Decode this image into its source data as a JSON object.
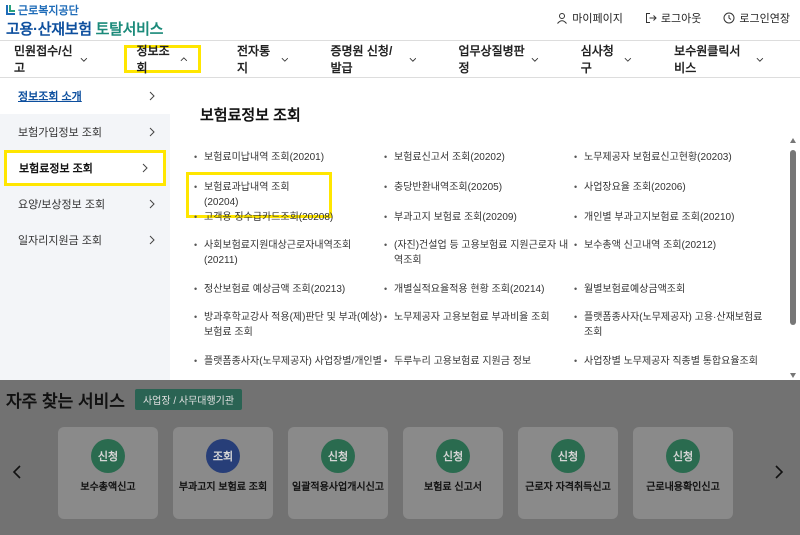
{
  "header": {
    "org": "근로복지공단",
    "service_main": "고용·산재보험",
    "service_sub": "토탈서비스",
    "links": [
      {
        "label": "마이페이지",
        "icon": "person-icon"
      },
      {
        "label": "로그아웃",
        "icon": "logout-icon"
      },
      {
        "label": "로그인연장",
        "icon": "clock-icon"
      }
    ]
  },
  "nav": {
    "items": [
      {
        "label": "민원접수/신고"
      },
      {
        "label": "정보조회"
      },
      {
        "label": "전자통지"
      },
      {
        "label": "증명원 신청/발급"
      },
      {
        "label": "업무상질병판정"
      },
      {
        "label": "심사청구"
      },
      {
        "label": "보수원클릭서비스"
      }
    ],
    "active_index": 1
  },
  "sidebar": {
    "items": [
      {
        "label": "정보조회 소개"
      },
      {
        "label": "보험가입정보 조회"
      },
      {
        "label": "보험료정보 조회"
      },
      {
        "label": "요양/보상정보 조회"
      },
      {
        "label": "일자리지원금 조회"
      }
    ]
  },
  "main": {
    "title": "보험료정보 조회",
    "menu_rows": [
      [
        "보험료미납내역 조회(20201)",
        "보험료신고서 조회(20202)",
        "노무제공자 보험료신고현황(20203)"
      ],
      [
        "보험료과납내역 조회(20204)",
        "충당반환내역조회(20205)",
        "사업장요율 조회(20206)"
      ],
      [
        "고객용 징수급카드조회(20208)",
        "부과고지 보험료 조회(20209)",
        "개인별 부과고지보험료 조회(20210)"
      ],
      [
        "사회보험료지원대상근로자내역조회(20211)",
        "(자진)건설업 등 고용보험료 지원근로자 내역조회",
        "보수총액 신고내역 조회(20212)"
      ],
      [
        "정산보험료 예상금액 조회(20213)",
        "개별실적요율적용 현황 조회(20214)",
        "월별보험료예상금액조회"
      ],
      [
        "방과후학교강사 적용(제)판단 및 부과(예상)보험료 조회",
        "노무제공자 고용보험료 부과비율 조회",
        "플랫폼종사자(노무제공자) 고용·산재보험료 조회"
      ],
      [
        "플랫폼종사자(노무제공자) 사업장별/개인별",
        "두루누리 고용보험료 지원금 정보",
        "사업장별 노무제공자 직종별 통합요율조회"
      ]
    ]
  },
  "frequent": {
    "title": "자주 찾는 서비스",
    "tag": "사업장 / 사무대행기관",
    "cards": [
      {
        "badge": "신청",
        "label": "보수총액신고",
        "color": "green"
      },
      {
        "badge": "조회",
        "label": "부과고지 보험료 조회",
        "color": "blue"
      },
      {
        "badge": "신청",
        "label": "일괄적용사업개시신고",
        "color": "green"
      },
      {
        "badge": "신청",
        "label": "보험료 신고서",
        "color": "green"
      },
      {
        "badge": "신청",
        "label": "근로자 자격취득신고",
        "color": "green"
      },
      {
        "badge": "신청",
        "label": "근로내용확인신고",
        "color": "green"
      }
    ]
  },
  "colors": {
    "highlight": "#ffe600",
    "brand_blue": "#0d4f9e",
    "brand_green": "#1b8a7a",
    "overlay": "#727272"
  }
}
